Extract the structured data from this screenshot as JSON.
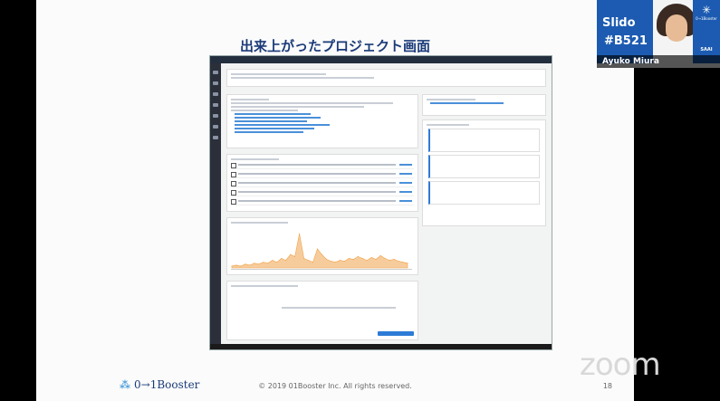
{
  "slide": {
    "title": "出来上がったプロジェクト画面",
    "copyright": "© 2019 01Booster Inc. All rights reserved.",
    "page_number": "18",
    "logo_text": "0→1Booster",
    "logo_mark": "⁂"
  },
  "video": {
    "slido_line1": "Slido",
    "slido_line2": "#B521",
    "brand_name": "0→1Booster",
    "brand_tag": "SAAI",
    "brand_star": "✳",
    "participant_name": "Ayuko Miura"
  },
  "zoom_watermark": "zoom",
  "colors": {
    "slide_title": "#1a3a78",
    "slido_blue": "#1c5bb1",
    "chart_series": "#f0a34a"
  },
  "chart_data": {
    "type": "area",
    "x": [
      1,
      2,
      3,
      4,
      5,
      6,
      7,
      8,
      9,
      10,
      11,
      12,
      13,
      14,
      15,
      16,
      17,
      18,
      19,
      20,
      21,
      22,
      23,
      24,
      25,
      26,
      27,
      28,
      29,
      30,
      31,
      32,
      33,
      34,
      35,
      36,
      37,
      38,
      39,
      40
    ],
    "series": [
      {
        "values": [
          2,
          3,
          2,
          4,
          3,
          5,
          4,
          6,
          5,
          8,
          6,
          10,
          8,
          14,
          12,
          36,
          10,
          8,
          6,
          20,
          14,
          9,
          7,
          6,
          8,
          7,
          10,
          9,
          12,
          10,
          8,
          11,
          9,
          13,
          10,
          8,
          9,
          7,
          6,
          5
        ]
      }
    ],
    "ylim": [
      0,
      40
    ],
    "xlabel": "",
    "ylabel": ""
  }
}
